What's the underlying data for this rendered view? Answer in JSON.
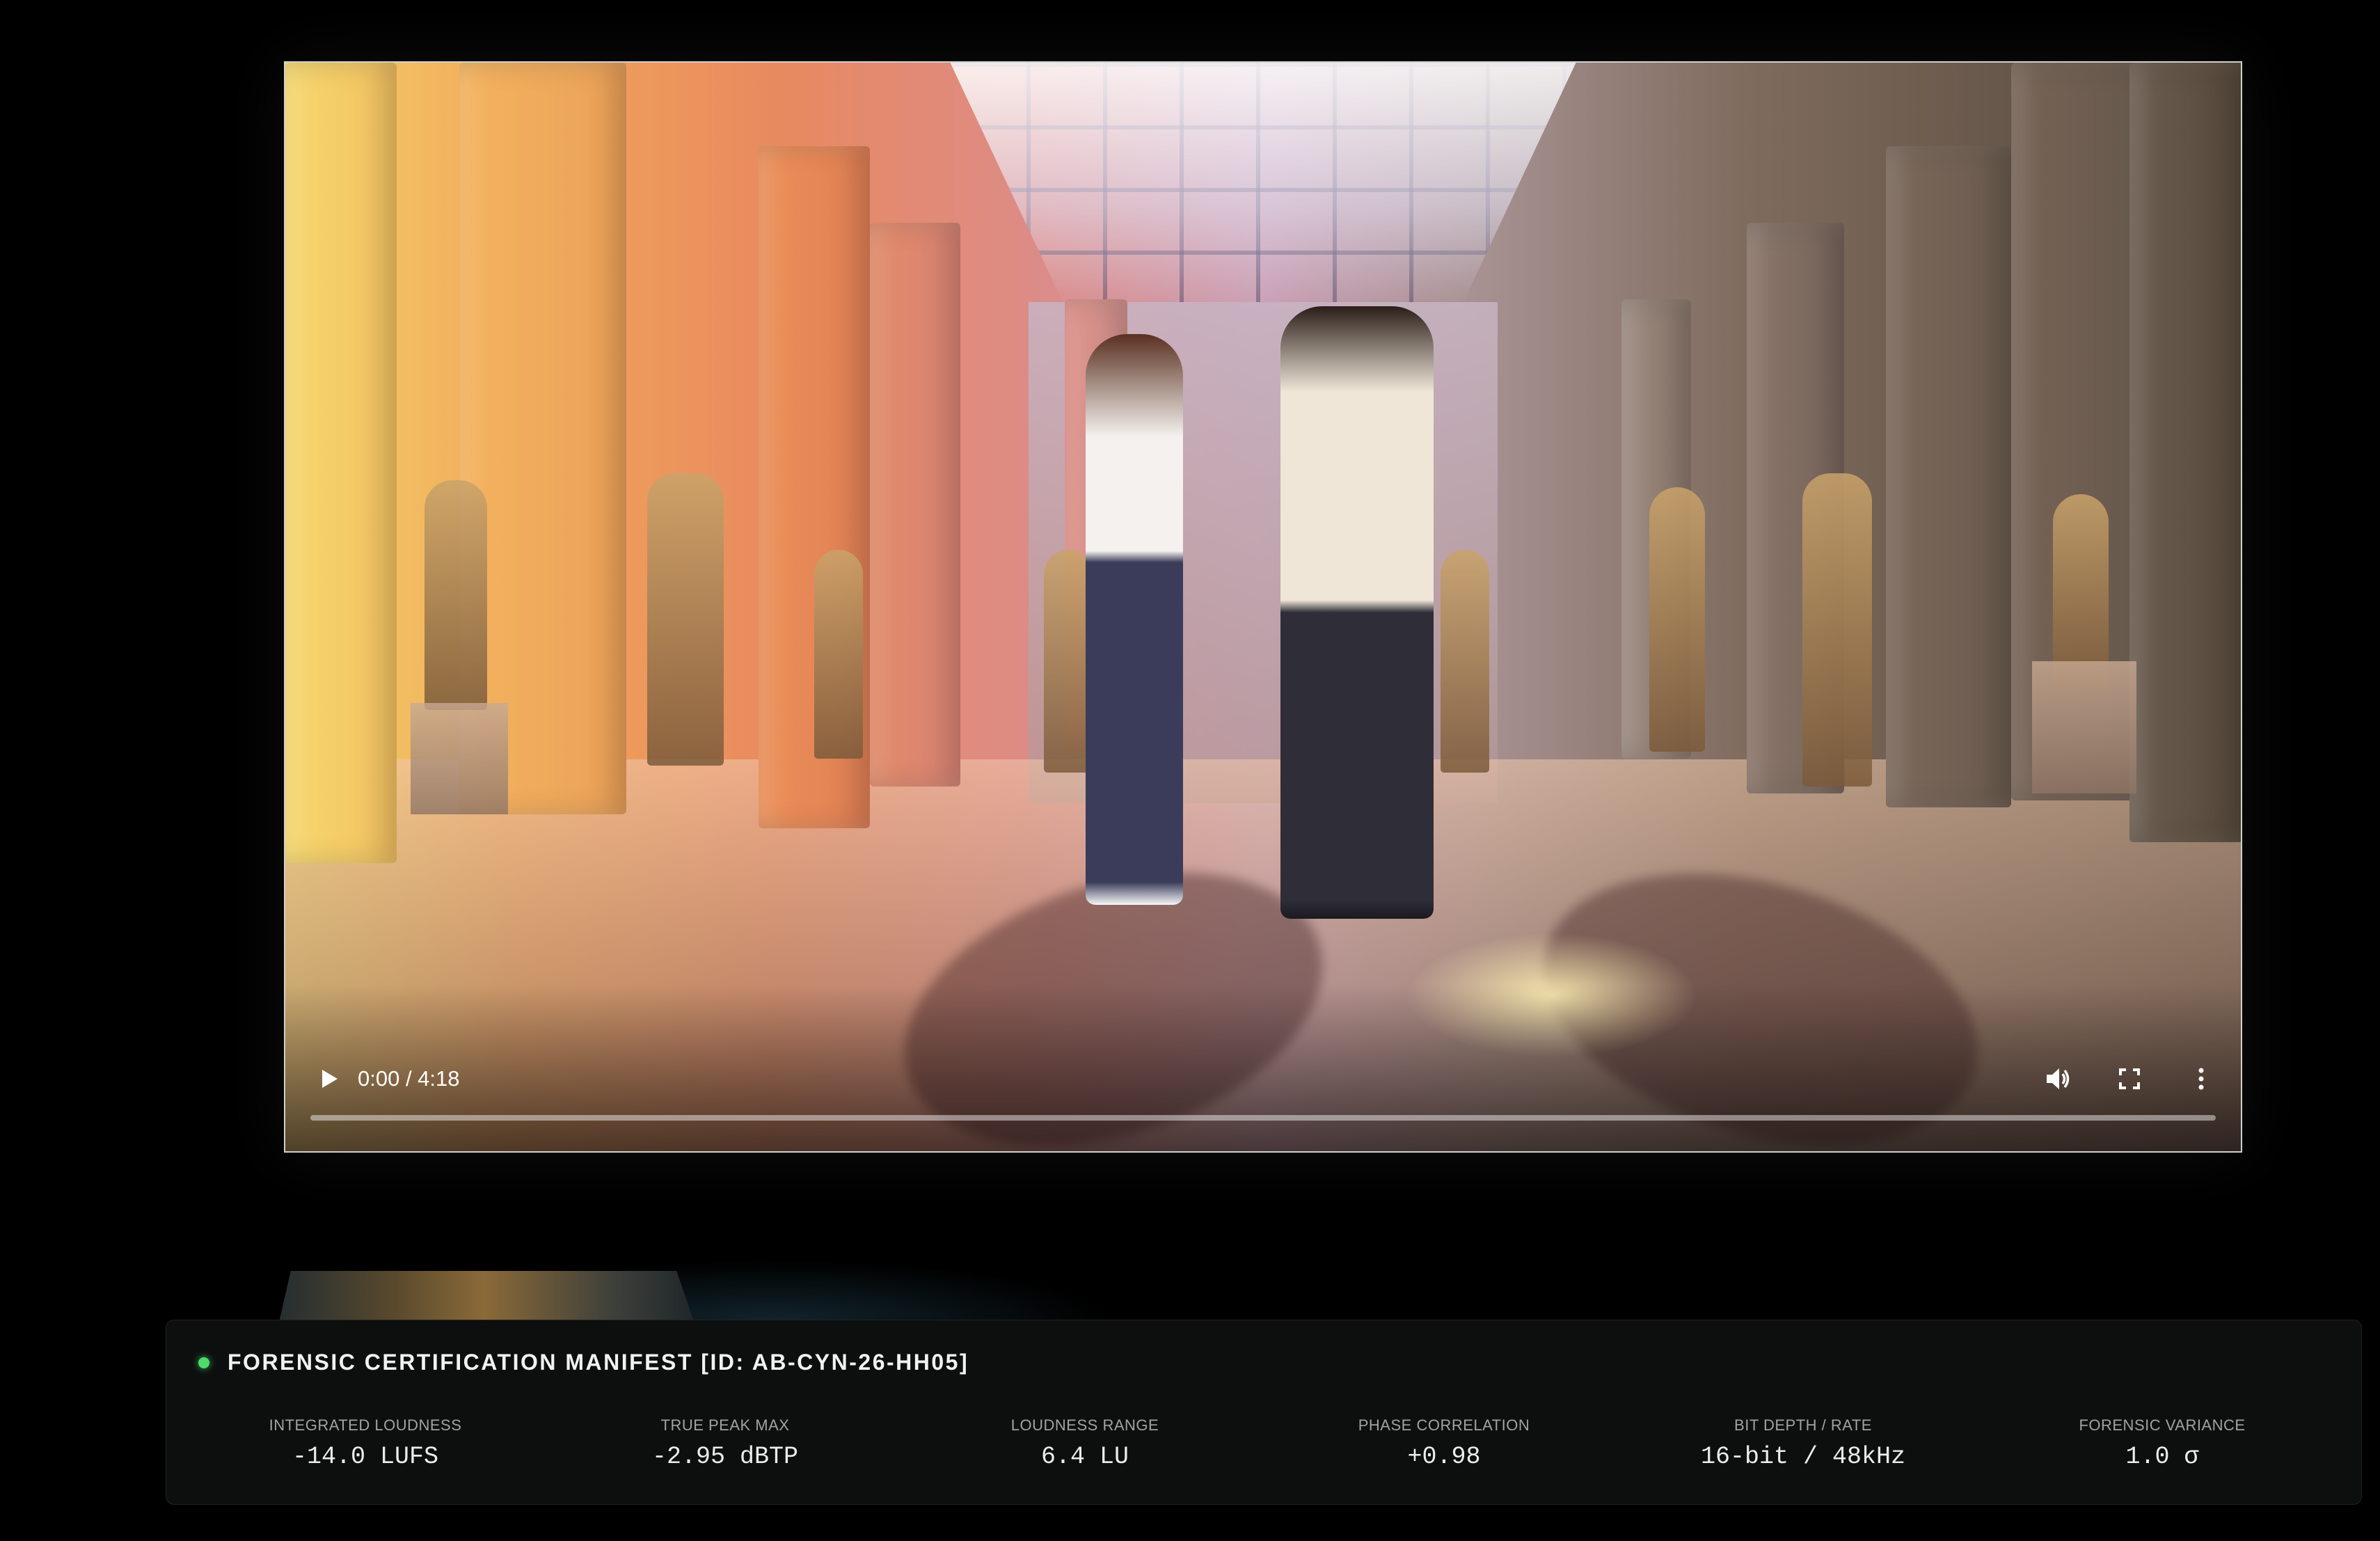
{
  "player": {
    "time_display": "0:00 / 4:18",
    "progress": 0,
    "icons": {
      "play": "play-icon",
      "volume": "volume-icon",
      "fullscreen": "fullscreen-icon",
      "more": "more-vertical-icon"
    }
  },
  "manifest": {
    "status_color": "#4ddb6a",
    "title": "FORENSIC CERTIFICATION MANIFEST [ID: AB-CYN-26-HH05]",
    "metrics": [
      {
        "label": "INTEGRATED LOUDNESS",
        "value": "-14.0 LUFS"
      },
      {
        "label": "TRUE PEAK MAX",
        "value": "-2.95 dBTP"
      },
      {
        "label": "LOUDNESS RANGE",
        "value": "6.4 LU"
      },
      {
        "label": "PHASE CORRELATION",
        "value": "+0.98"
      },
      {
        "label": "BIT DEPTH / RATE",
        "value": "16-bit / 48kHz"
      },
      {
        "label": "FORENSIC VARIANCE",
        "value": "1.0 σ"
      }
    ]
  }
}
